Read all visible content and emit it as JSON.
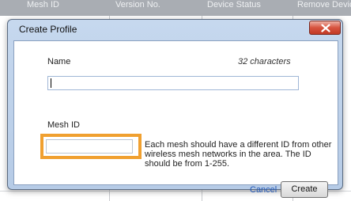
{
  "background_table": {
    "columns": [
      "Mesh ID",
      "Version No.",
      "Device Status",
      "Remove Devic"
    ]
  },
  "dialog": {
    "title": "Create Profile",
    "name_label": "Name",
    "name_hint": "32 characters",
    "name_value": "",
    "mesh_id_label": "Mesh ID",
    "mesh_id_value": "",
    "mesh_id_help": "Each mesh should have a different ID from other wireless mesh networks in the area. The ID should be from 1-255.",
    "cancel_label": "Cancel",
    "create_label": "Create"
  },
  "colors": {
    "highlight": "#f0a030",
    "link": "#1f55b5",
    "close_button": "#d7533f"
  },
  "icons": {
    "close": "close-icon"
  }
}
